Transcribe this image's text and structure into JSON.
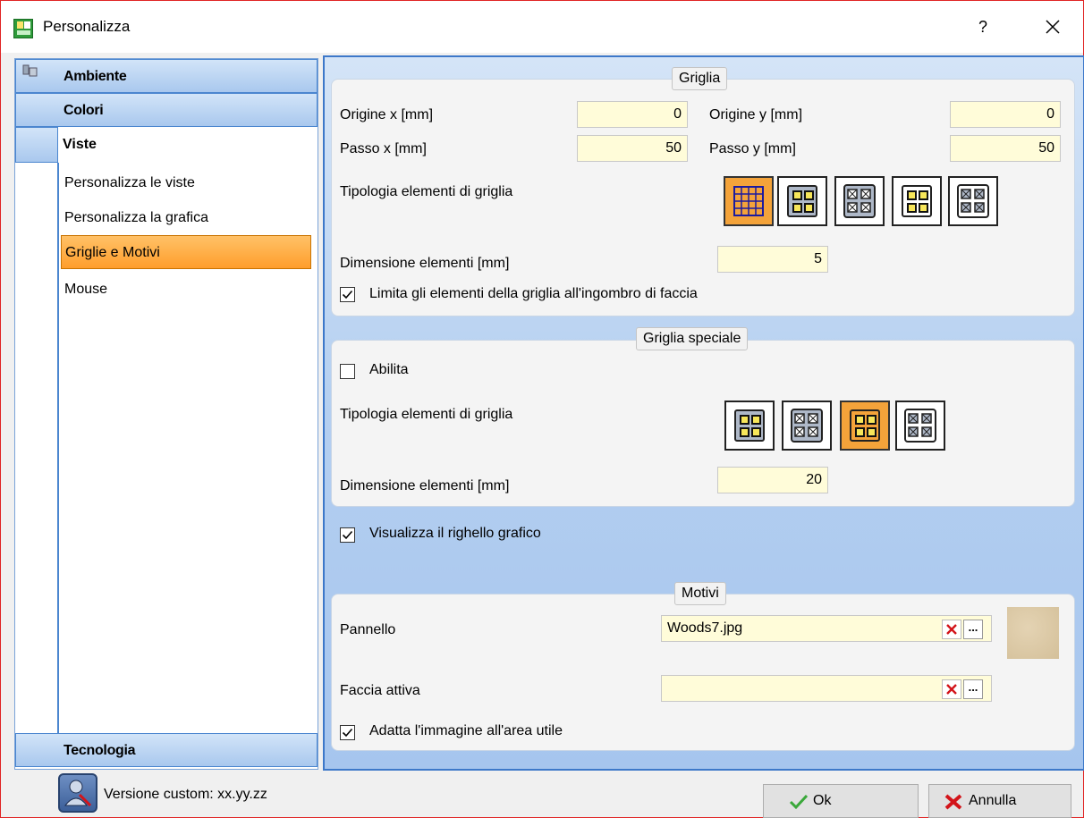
{
  "window": {
    "title": "Personalizza",
    "help": "?",
    "close": "×"
  },
  "sidebar": {
    "ambiente": "Ambiente",
    "colori": "Colori",
    "viste": "Viste",
    "items": [
      "Personalizza le viste",
      "Personalizza la grafica",
      "Griglie e Motivi",
      "Mouse"
    ],
    "selected_index": 2,
    "tecnologia": "Tecnologia"
  },
  "griglia": {
    "title": "Griglia",
    "origine_x_label": "Origine x [mm]",
    "origine_x_value": "0",
    "origine_y_label": "Origine y [mm]",
    "origine_y_value": "0",
    "passo_x_label": "Passo x [mm]",
    "passo_x_value": "50",
    "passo_y_label": "Passo y [mm]",
    "passo_y_value": "50",
    "tipologia_label": "Tipologia elementi di griglia",
    "dimensione_label": "Dimensione elementi [mm]",
    "dimensione_value": "5",
    "limita_label": "Limita gli elementi della griglia all'ingombro di faccia",
    "limita_checked": true
  },
  "griglia_speciale": {
    "title": "Griglia speciale",
    "abilita_label": "Abilita",
    "abilita_checked": false,
    "tipologia_label": "Tipologia elementi di griglia",
    "dimensione_label": "Dimensione elementi [mm]",
    "dimensione_value": "20"
  },
  "righello": {
    "label": "Visualizza il righello grafico",
    "checked": true
  },
  "motivi": {
    "title": "Motivi",
    "pannello_label": "Pannello",
    "pannello_value": "Woods7.jpg",
    "faccia_label": "Faccia attiva",
    "faccia_value": "",
    "adatta_label": "Adatta l'immagine all'area utile",
    "adatta_checked": true,
    "browse": "..."
  },
  "footer": {
    "version": "Versione custom: xx.yy.zz",
    "ok": "Ok",
    "annulla": "Annulla"
  },
  "colors": {
    "selection": "#ff9e2c",
    "field_bg": "#fffcd9",
    "accent_blue": "#3d78c9"
  }
}
